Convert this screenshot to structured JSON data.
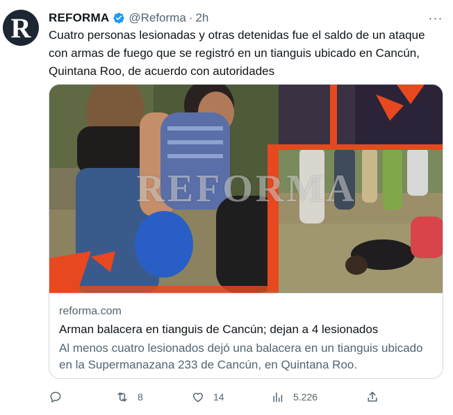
{
  "tweet": {
    "author_name": "REFORMA",
    "handle": "@Reforma",
    "separator": "·",
    "time": "2h",
    "more_label": "···",
    "text": "Cuatro personas lesionadas y otras detenidas fue el saldo de un ataque con armas de fuego que se registró en un tianguis ubicado en Cancún, Quintana Roo, de acuerdo con autoridades"
  },
  "avatar": {
    "letter": "R"
  },
  "card": {
    "watermark": "REFORMA",
    "domain": "reforma.com",
    "title": "Arman balacera en tianguis de Cancún; dejan a 4 lesionados",
    "description": "Al menos cuatro lesionados dejó una balacera en un tianguis ubicado en la Supermanazana 233 de Cancún, en Quintana Roo."
  },
  "actions": {
    "reply_count": "",
    "retweet_count": "8",
    "like_count": "14",
    "views_count": "5.226",
    "share_count": ""
  },
  "colors": {
    "text_primary": "#0f1419",
    "text_secondary": "#536471",
    "verified_blue": "#1d9bf0",
    "border": "#cfd9de",
    "accent_orange": "#e8481f"
  }
}
